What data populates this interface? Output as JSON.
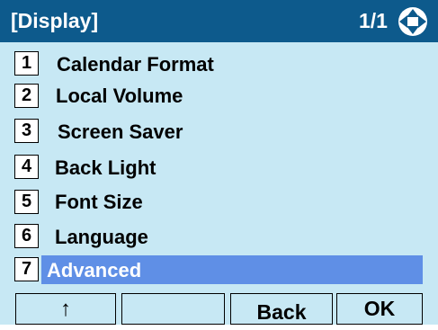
{
  "header": {
    "title": "[Display]",
    "page_indicator": "1/1",
    "nav_icon": "up-down-arrows-icon"
  },
  "menu": {
    "items": [
      {
        "number": "1",
        "label": "Calendar Format"
      },
      {
        "number": "2",
        "label": "Local Volume"
      },
      {
        "number": "3",
        "label": "Screen Saver"
      },
      {
        "number": "4",
        "label": "Back Light"
      },
      {
        "number": "5",
        "label": "Font Size"
      },
      {
        "number": "6",
        "label": "Language"
      },
      {
        "number": "7",
        "label": "Advanced"
      }
    ],
    "selected_index": 6
  },
  "softkeys": [
    {
      "label": "↑"
    },
    {
      "label": ""
    },
    {
      "label": "Back"
    },
    {
      "label": "OK"
    }
  ],
  "colors": {
    "header_bg": "#0d5a8c",
    "screen_bg": "#c7e8f4",
    "selection_bg": "#5f8fe6"
  }
}
